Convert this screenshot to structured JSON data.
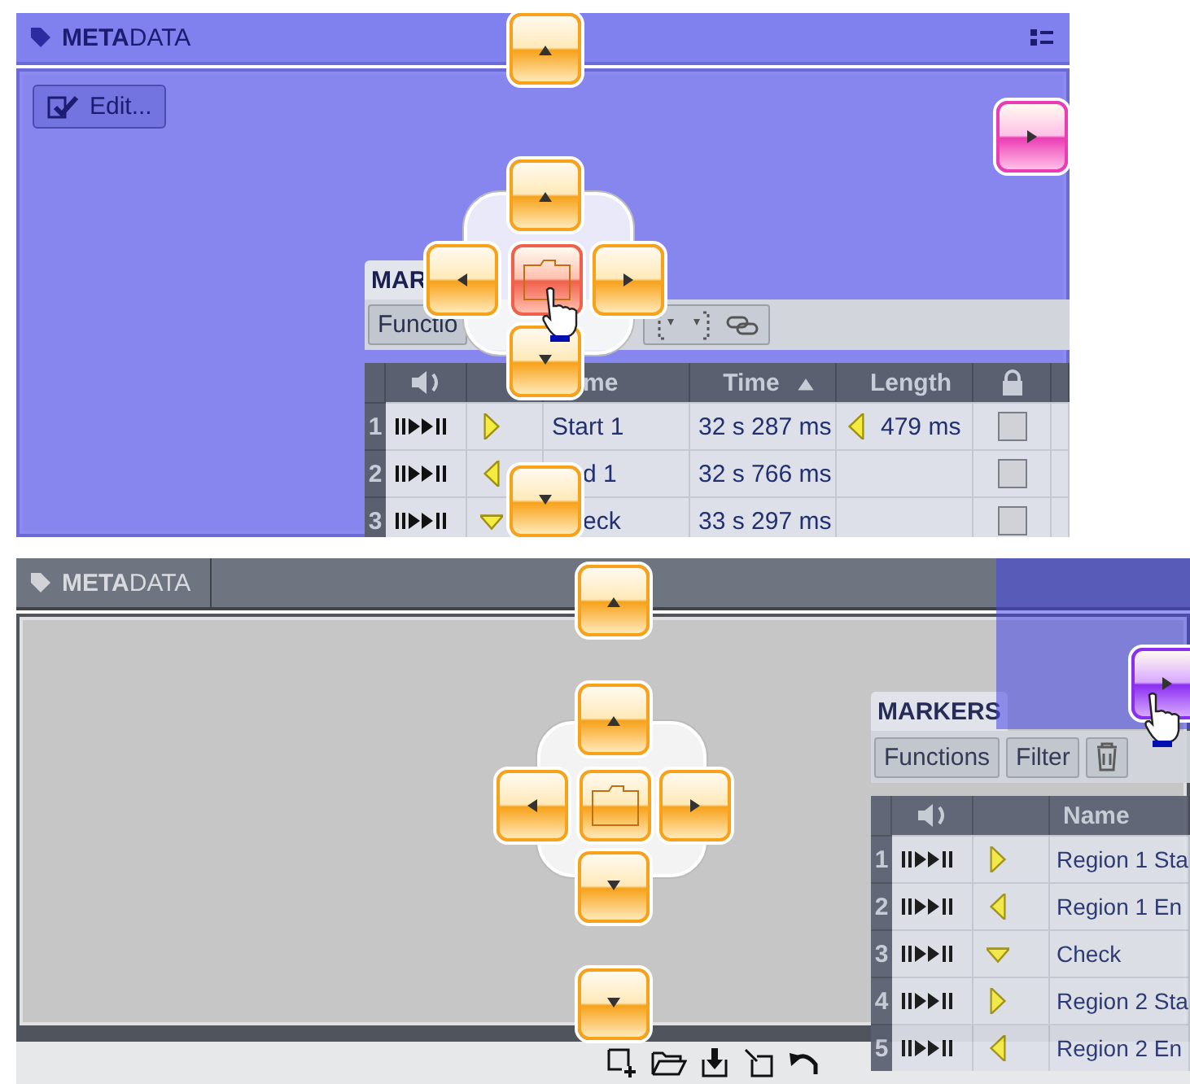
{
  "scenes": [
    {
      "kind": "center-target",
      "panel": {
        "title": "**META**DATA"
      },
      "edit_button": "Edit...",
      "outer_guides": [
        {
          "kind": "top",
          "color": "#f7a21a"
        },
        {
          "kind": "bottom",
          "color": "#f7a21a"
        },
        {
          "kind": "right",
          "color": "#ec3cb4"
        }
      ],
      "cross_guides": [
        {
          "kind": "up",
          "color": "#f7a21a"
        },
        {
          "kind": "left",
          "color": "#f7a21a"
        },
        {
          "kind": "center",
          "color": "#f0604a"
        },
        {
          "kind": "right",
          "color": "#f7a21a"
        },
        {
          "kind": "down",
          "color": "#f7a21a"
        }
      ],
      "markers": {
        "title": "MAR",
        "buttons": [
          "Functio"
        ],
        "tools": [
          {
            "kind": "bracket-start"
          },
          {
            "kind": "bracket-end"
          },
          {
            "kind": "link"
          }
        ],
        "columns": [
          {
            "kind": "speaker"
          },
          {
            "kind": "blank"
          },
          {
            "kind": "text",
            "label": "me",
            "covered": true
          },
          {
            "kind": "text",
            "label": "Time",
            "sorted": true
          },
          {
            "kind": "text",
            "label": "Length",
            "sorted": false
          },
          {
            "kind": "lock"
          }
        ],
        "rows": [
          {
            "number": "1",
            "kind": "start",
            "name": "Start 1",
            "covered": false,
            "time": "32 s 287 ms",
            "length": "479 ms",
            "locked": false
          },
          {
            "number": "2",
            "kind": "end",
            "name": "d 1",
            "covered": true,
            "time": "32 s 766 ms",
            "locked": false
          },
          {
            "number": "3",
            "kind": "generic",
            "name": "eck",
            "covered": true,
            "time": "33 s 297 ms",
            "locked": false
          }
        ]
      }
    },
    {
      "kind": "edge-target",
      "panel": {
        "title": "**META**DATA"
      },
      "outer_guides": [
        {
          "kind": "top",
          "color": "#f7a21a"
        },
        {
          "kind": "bottom",
          "color": "#f7a21a"
        },
        {
          "kind": "right",
          "color": "#8a2ef0"
        }
      ],
      "cross_guides": [
        {
          "kind": "up",
          "color": "#f7a21a"
        },
        {
          "kind": "left",
          "color": "#f7a21a"
        },
        {
          "kind": "center",
          "color": "#f7a21a"
        },
        {
          "kind": "right",
          "color": "#f7a21a"
        },
        {
          "kind": "down",
          "color": "#f7a21a"
        }
      ],
      "markers": {
        "title": "MARKERS",
        "buttons": [
          "Functions",
          "Filter"
        ],
        "tools": [
          {
            "kind": "trash"
          }
        ],
        "columns": [
          {
            "kind": "speaker"
          },
          {
            "kind": "blank"
          },
          {
            "kind": "text",
            "label": "Name"
          }
        ],
        "rows": [
          {
            "number": "1",
            "kind": "start",
            "name": "Region 1 Sta"
          },
          {
            "number": "2",
            "kind": "end",
            "name": "Region 1 En"
          },
          {
            "number": "3",
            "kind": "generic",
            "name": "Check"
          },
          {
            "number": "4",
            "kind": "start",
            "name": "Region 2 Sta"
          },
          {
            "number": "5",
            "kind": "end",
            "name": "Region 2 En"
          }
        ]
      },
      "bottom_tools": [
        {
          "kind": "new-window"
        },
        {
          "kind": "open-folder"
        },
        {
          "kind": "save"
        },
        {
          "kind": "pick"
        },
        {
          "kind": "undo"
        }
      ]
    }
  ]
}
